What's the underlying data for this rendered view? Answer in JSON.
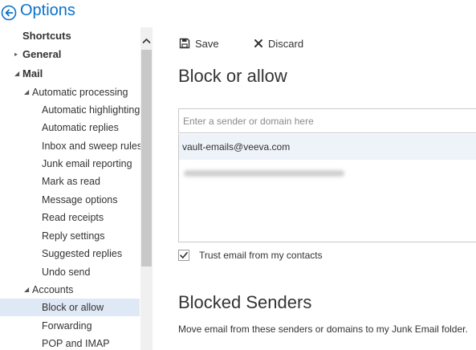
{
  "header": {
    "title": "Options",
    "back_icon": "back-arrow-circle-icon"
  },
  "nav": {
    "items": [
      {
        "label": "Shortcuts",
        "level": 0,
        "bold": true,
        "expander": "none"
      },
      {
        "label": "General",
        "level": 0,
        "bold": true,
        "expander": "collapsed"
      },
      {
        "label": "Mail",
        "level": 0,
        "bold": true,
        "expander": "expanded"
      },
      {
        "label": "Automatic processing",
        "level": 1,
        "bold": false,
        "expander": "expanded"
      },
      {
        "label": "Automatic highlighting",
        "level": 2,
        "bold": false,
        "expander": "none"
      },
      {
        "label": "Automatic replies",
        "level": 2,
        "bold": false,
        "expander": "none"
      },
      {
        "label": "Inbox and sweep rules",
        "level": 2,
        "bold": false,
        "expander": "none"
      },
      {
        "label": "Junk email reporting",
        "level": 2,
        "bold": false,
        "expander": "none"
      },
      {
        "label": "Mark as read",
        "level": 2,
        "bold": false,
        "expander": "none"
      },
      {
        "label": "Message options",
        "level": 2,
        "bold": false,
        "expander": "none"
      },
      {
        "label": "Read receipts",
        "level": 2,
        "bold": false,
        "expander": "none"
      },
      {
        "label": "Reply settings",
        "level": 2,
        "bold": false,
        "expander": "none"
      },
      {
        "label": "Suggested replies",
        "level": 2,
        "bold": false,
        "expander": "none"
      },
      {
        "label": "Undo send",
        "level": 2,
        "bold": false,
        "expander": "none"
      },
      {
        "label": "Accounts",
        "level": 1,
        "bold": false,
        "expander": "expanded"
      },
      {
        "label": "Block or allow",
        "level": 2,
        "bold": false,
        "expander": "none",
        "selected": true
      },
      {
        "label": "Forwarding",
        "level": 2,
        "bold": false,
        "expander": "none"
      },
      {
        "label": "POP and IMAP",
        "level": 2,
        "bold": false,
        "expander": "none"
      }
    ]
  },
  "toolbar": {
    "save_label": "Save",
    "discard_label": "Discard"
  },
  "main": {
    "title": "Block or allow",
    "sender_input_placeholder": "Enter a sender or domain here",
    "allowed_list": [
      "vault-emails@veeva.com"
    ],
    "trust_label": "Trust email from my contacts",
    "trust_checked": true,
    "blocked_title": "Blocked Senders",
    "blocked_desc": "Move email from these senders or domains to my Junk Email folder."
  },
  "colors": {
    "accent": "#0a72c9",
    "selected_bg": "#dfe9f5",
    "scroll_thumb": "#c8c8c8"
  }
}
